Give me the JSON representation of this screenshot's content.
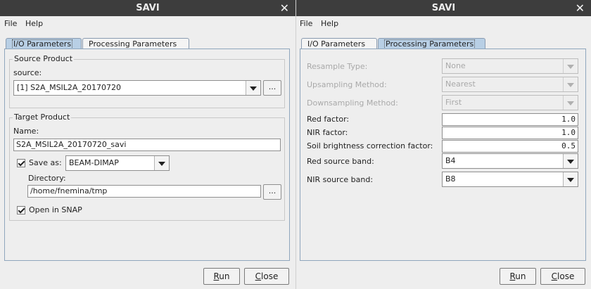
{
  "left": {
    "title": "SAVI",
    "menu": [
      "File",
      "Help"
    ],
    "tabs": [
      "I/O Parameters",
      "Processing Parameters"
    ],
    "source_product": {
      "group_title": "Source Product",
      "source_label": "source:",
      "source_value": "[1] S2A_MSIL2A_20170720",
      "browse_label": "..."
    },
    "target_product": {
      "group_title": "Target Product",
      "name_label": "Name:",
      "name_value": "S2A_MSIL2A_20170720_savi",
      "save_as_label": "Save as:",
      "save_as_checked": true,
      "format_value": "BEAM-DIMAP",
      "directory_label": "Directory:",
      "directory_value": "/home/fnemina/tmp",
      "browse_label": "...",
      "open_in_snap_label": "Open in SNAP",
      "open_in_snap_checked": true
    },
    "buttons": {
      "run_first": "R",
      "run_rest": "un",
      "close_first": "C",
      "close_rest": "lose"
    }
  },
  "right": {
    "title": "SAVI",
    "menu": [
      "File",
      "Help"
    ],
    "tabs": [
      "I/O Parameters",
      "Processing Parameters"
    ],
    "params": {
      "resample_type_label": "Resample Type:",
      "resample_type_value": "None",
      "upsampling_label": "Upsampling Method:",
      "upsampling_value": "Nearest",
      "downsampling_label": "Downsampling Method:",
      "downsampling_value": "First",
      "red_factor_label": "Red factor:",
      "red_factor_value": "1.0",
      "nir_factor_label": "NIR factor:",
      "nir_factor_value": "1.0",
      "soil_label": "Soil brightness correction factor:",
      "soil_value": "0.5",
      "red_band_label": "Red source band:",
      "red_band_value": "B4",
      "nir_band_label": "NIR source band:",
      "nir_band_value": "B8"
    },
    "buttons": {
      "run_first": "R",
      "run_rest": "un",
      "close_first": "C",
      "close_rest": "lose"
    }
  },
  "colors": {
    "titlebar": "#3d3d3d",
    "active_tab": "#b8cfe5",
    "panel_border": "#8fa6bd",
    "disabled_text": "#a9a9a9"
  },
  "icons": {
    "close": "close-icon",
    "dropdown": "chevron-down-icon",
    "checkbox": "check-icon"
  }
}
